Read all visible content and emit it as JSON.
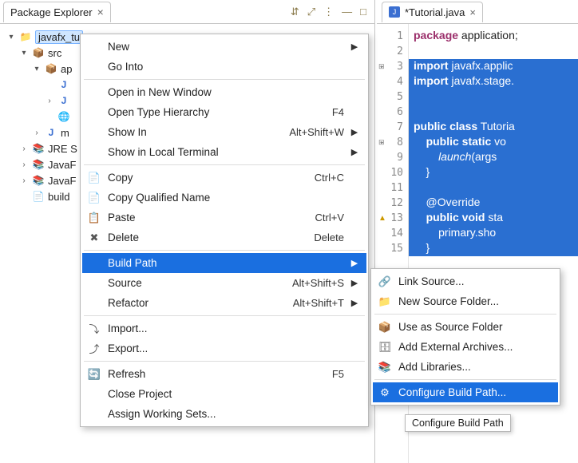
{
  "pkg_panel": {
    "tab_title": "Package Explorer",
    "toolbar_icons": [
      "⇵",
      "⤢",
      "⋮",
      "—",
      "□"
    ],
    "tree": {
      "project": {
        "arrow": "▾",
        "icon": "📁",
        "label": "javafx_tu",
        "selected": true
      },
      "src": {
        "arrow": "▾",
        "icon": "📦",
        "label": "src"
      },
      "pkg": {
        "arrow": "▾",
        "icon": "📦",
        "label": "ap"
      },
      "file1": {
        "arrow": "",
        "icon": "J",
        "label": ""
      },
      "file2": {
        "arrow": "›",
        "icon": "J",
        "label": ""
      },
      "file3": {
        "arrow": "",
        "icon": "🌐",
        "label": ""
      },
      "mod": {
        "arrow": "›",
        "icon": "J",
        "label": "m"
      },
      "jre": {
        "arrow": "›",
        "icon": "📚",
        "label": "JRE S"
      },
      "jfx1": {
        "arrow": "›",
        "icon": "📚",
        "label": "JavaF"
      },
      "jfx2": {
        "arrow": "›",
        "icon": "📚",
        "label": "JavaF"
      },
      "build": {
        "arrow": "",
        "icon": "📄",
        "label": "build"
      }
    }
  },
  "editor": {
    "tab_title": "*Tutorial.java",
    "lines": [
      {
        "n": "1",
        "hl": false,
        "text": "package application;",
        "parts": [
          [
            "kw-plain",
            "package"
          ],
          [
            "",
            " application;"
          ]
        ]
      },
      {
        "n": "2",
        "hl": false,
        "text": ""
      },
      {
        "n": "3",
        "hl": true,
        "text": "import javafx.applic",
        "fold": true,
        "parts": [
          [
            "kw",
            "import"
          ],
          [
            "",
            " javafx.applic"
          ]
        ]
      },
      {
        "n": "4",
        "hl": true,
        "text": "import javafx.stage.",
        "parts": [
          [
            "kw",
            "import"
          ],
          [
            "",
            " javafx.stage."
          ]
        ]
      },
      {
        "n": "5",
        "hl": true,
        "text": ""
      },
      {
        "n": "6",
        "hl": true,
        "text": ""
      },
      {
        "n": "7",
        "hl": true,
        "text": "public class Tutoria",
        "parts": [
          [
            "kw",
            "public class"
          ],
          [
            "",
            " Tutoria"
          ]
        ]
      },
      {
        "n": "8",
        "hl": true,
        "text": "    public static vo",
        "fold": true,
        "parts": [
          [
            "",
            "    "
          ],
          [
            "kw",
            "public static"
          ],
          [
            "",
            " vo"
          ]
        ]
      },
      {
        "n": "9",
        "hl": true,
        "text": "        launch(args",
        "parts": [
          [
            "",
            "        "
          ],
          [
            "it",
            "launch"
          ],
          [
            "",
            "(args"
          ]
        ]
      },
      {
        "n": "10",
        "hl": true,
        "text": "    }"
      },
      {
        "n": "11",
        "hl": true,
        "text": ""
      },
      {
        "n": "12",
        "hl": true,
        "text": "    @Override"
      },
      {
        "n": "13",
        "hl": true,
        "text": "    public void sta",
        "warn": true,
        "parts": [
          [
            "",
            "    "
          ],
          [
            "kw",
            "public void"
          ],
          [
            "",
            " sta"
          ]
        ]
      },
      {
        "n": "14",
        "hl": true,
        "text": "        primary.sho"
      },
      {
        "n": "15",
        "hl": true,
        "text": "    }"
      }
    ]
  },
  "context_menu": {
    "items": [
      {
        "icon": "",
        "label": "New",
        "accel": "",
        "submenu": true
      },
      {
        "icon": "",
        "label": "Go Into"
      },
      "sep",
      {
        "icon": "",
        "label": "Open in New Window"
      },
      {
        "icon": "",
        "label": "Open Type Hierarchy",
        "accel": "F4"
      },
      {
        "icon": "",
        "label": "Show In",
        "accel": "Alt+Shift+W",
        "submenu": true
      },
      {
        "icon": "",
        "label": "Show in Local Terminal",
        "submenu": true
      },
      "sep",
      {
        "icon": "📄",
        "label": "Copy",
        "accel": "Ctrl+C"
      },
      {
        "icon": "📄",
        "label": "Copy Qualified Name"
      },
      {
        "icon": "📋",
        "label": "Paste",
        "accel": "Ctrl+V"
      },
      {
        "icon": "✖",
        "label": "Delete",
        "accel": "Delete"
      },
      "sep",
      {
        "icon": "",
        "label": "Build Path",
        "submenu": true,
        "highlight": true
      },
      {
        "icon": "",
        "label": "Source",
        "accel": "Alt+Shift+S",
        "submenu": true
      },
      {
        "icon": "",
        "label": "Refactor",
        "accel": "Alt+Shift+T",
        "submenu": true
      },
      "sep",
      {
        "icon": "⤵",
        "label": "Import..."
      },
      {
        "icon": "⤴",
        "label": "Export..."
      },
      "sep",
      {
        "icon": "🔄",
        "label": "Refresh",
        "accel": "F5"
      },
      {
        "icon": "",
        "label": "Close Project"
      },
      {
        "icon": "",
        "label": "Assign Working Sets..."
      }
    ]
  },
  "submenu": {
    "items": [
      {
        "icon": "🔗",
        "label": "Link Source..."
      },
      {
        "icon": "📁",
        "label": "New Source Folder..."
      },
      "sep",
      {
        "icon": "📦",
        "label": "Use as Source Folder"
      },
      {
        "icon": "🗄",
        "label": "Add External Archives..."
      },
      {
        "icon": "📚",
        "label": "Add Libraries..."
      },
      "sep",
      {
        "icon": "⚙",
        "label": "Configure Build Path...",
        "highlight": true
      }
    ]
  },
  "tooltip": "Configure Build Path"
}
